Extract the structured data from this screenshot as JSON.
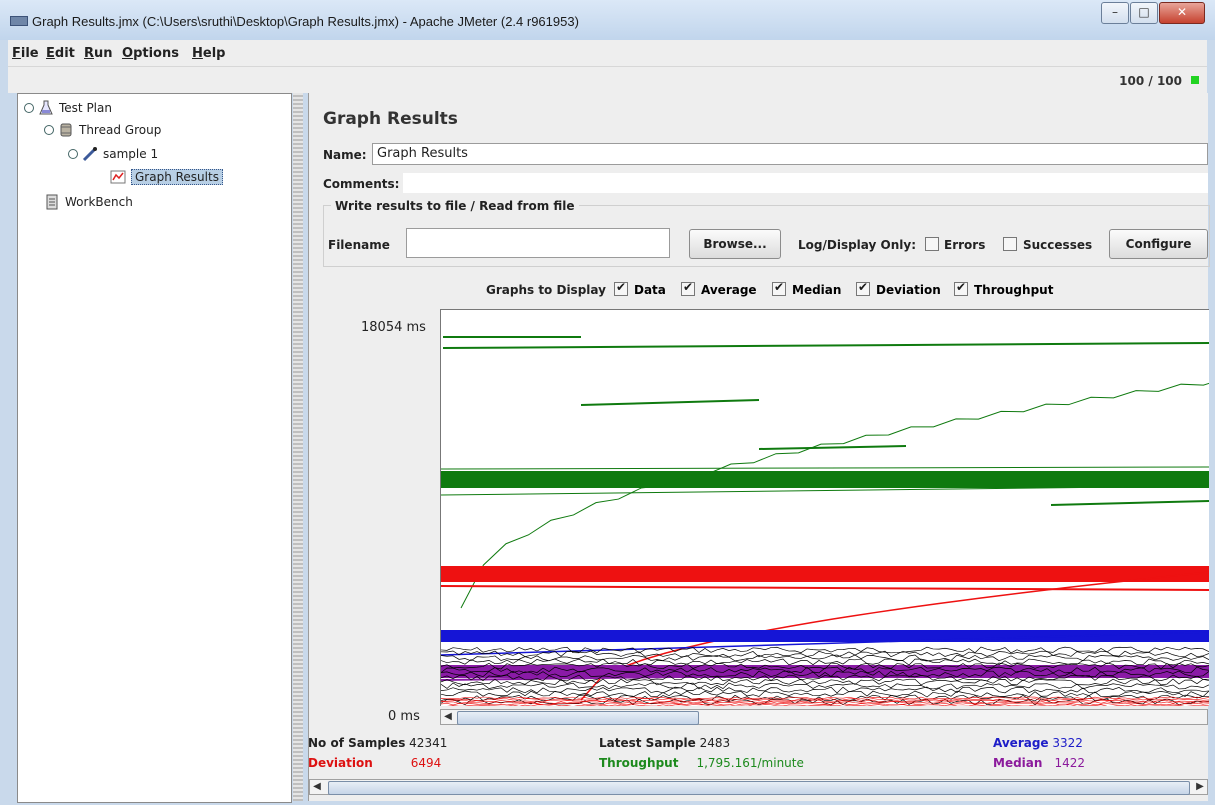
{
  "window": {
    "title": "Graph Results.jmx (C:\\Users\\sruthi\\Desktop\\Graph Results.jmx) - Apache JMeter (2.4 r961953)"
  },
  "menu": [
    "File",
    "Edit",
    "Run",
    "Options",
    "Help"
  ],
  "status": {
    "counter": "100 / 100"
  },
  "tree": {
    "items": [
      {
        "label": "Test Plan"
      },
      {
        "label": "Thread Group"
      },
      {
        "label": "sample 1"
      },
      {
        "label": "Graph Results"
      },
      {
        "label": "WorkBench"
      }
    ]
  },
  "panel": {
    "title": "Graph Results",
    "name_label": "Name:",
    "name_value": "Graph Results",
    "comments_label": "Comments:",
    "comments_value": "",
    "file_group_title": "Write results to file / Read from file",
    "filename_label": "Filename",
    "filename_value": "",
    "browse_label": "Browse...",
    "log_display_label": "Log/Display Only:",
    "errors_label": "Errors",
    "successes_label": "Successes",
    "configure_label": "Configure"
  },
  "graphs_to_display": {
    "label": "Graphs to Display",
    "options": [
      {
        "label": "Data",
        "checked": true,
        "color": "#000000"
      },
      {
        "label": "Average",
        "checked": true,
        "color": "#1d1dc8"
      },
      {
        "label": "Median",
        "checked": true,
        "color": "#8b1a9c"
      },
      {
        "label": "Deviation",
        "checked": true,
        "color": "#dd1111"
      },
      {
        "label": "Throughput",
        "checked": true,
        "color": "#1d8a1d"
      }
    ]
  },
  "chart_data": {
    "type": "line",
    "y_max_label": "18054  ms",
    "y_min_label": "0  ms",
    "ylim": [
      0,
      18054
    ],
    "series": [
      {
        "name": "Throughput",
        "color": "#0f7a0f"
      },
      {
        "name": "Deviation",
        "color": "#ee1111"
      },
      {
        "name": "Average",
        "color": "#1515d6"
      },
      {
        "name": "Median",
        "color": "#8a1aa6"
      },
      {
        "name": "Data",
        "color": "#000000"
      }
    ]
  },
  "stats": {
    "no_samples_label": "No of Samples",
    "no_samples_value": "42341",
    "latest_label": "Latest Sample",
    "latest_value": "2483",
    "average_label": "Average",
    "average_value": "3322",
    "deviation_label": "Deviation",
    "deviation_value": "6494",
    "throughput_label": "Throughput",
    "throughput_value": "1,795.161/minute",
    "median_label": "Median",
    "median_value": "1422"
  }
}
